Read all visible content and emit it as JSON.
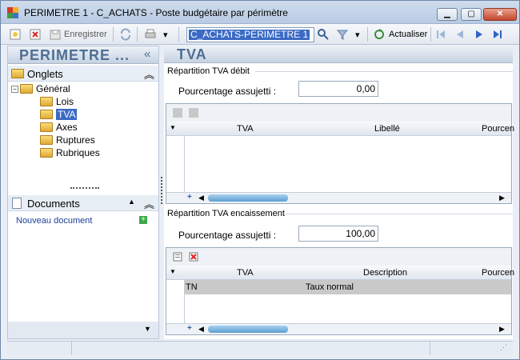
{
  "window": {
    "title": "PERIMETRE 1 - C_ACHATS -  Poste budgétaire par périmètre"
  },
  "toolbar": {
    "save_label": "Enregistrer",
    "combo_value": "C_ACHATS-PERIMETRE 1",
    "refresh_label": "Actualiser"
  },
  "left": {
    "header": "PERIMETRE ...",
    "onglets_label": "Onglets",
    "tree": [
      "Général",
      "Lois",
      "TVA",
      "Axes",
      "Ruptures",
      "Rubriques"
    ],
    "documents_label": "Documents",
    "new_doc": "Nouveau document"
  },
  "main": {
    "header": "TVA",
    "debit": {
      "group": "Répartition TVA débit",
      "field_label": "Pourcentage assujetti  :",
      "value": "0,00",
      "columns": [
        "TVA",
        "Libellé",
        "Pourcen"
      ]
    },
    "encaissement": {
      "group": "Répartition TVA encaissement",
      "field_label": "Pourcentage assujetti  :",
      "value": "100,00",
      "columns": [
        "TVA",
        "Description",
        "Pourcen"
      ],
      "rows": [
        {
          "tva": "TN",
          "description": "Taux normal"
        }
      ]
    }
  },
  "colors": {
    "accent": "#3a6ac4",
    "header_text": "#4e6f93",
    "close": "#c4452c"
  }
}
